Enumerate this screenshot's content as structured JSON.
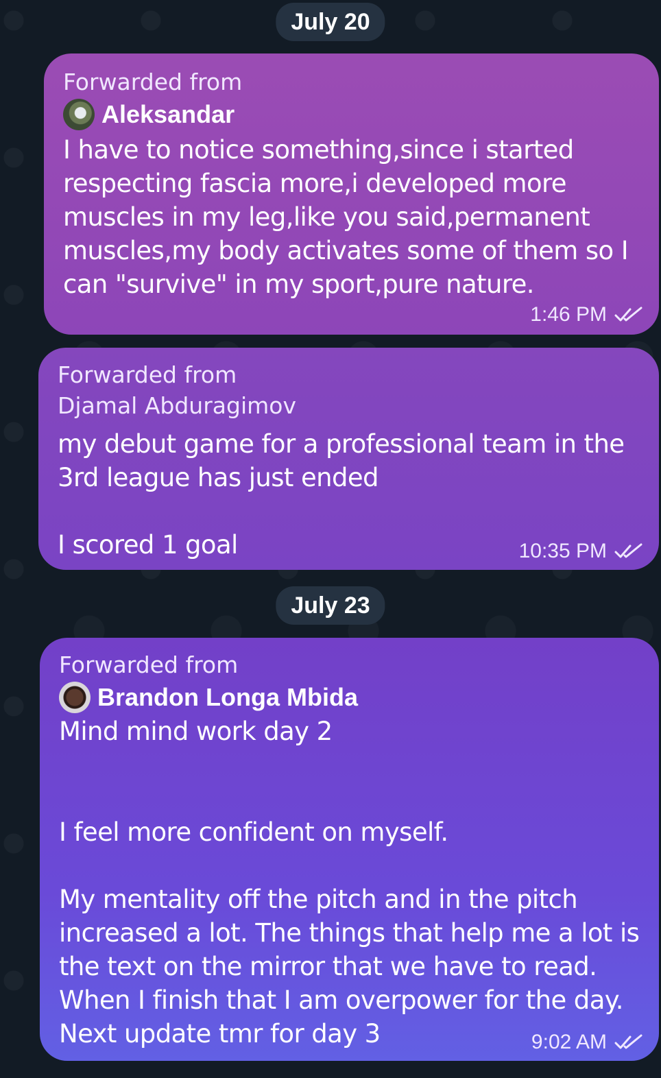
{
  "chat": {
    "date_1": "July 20",
    "date_2": "July 23",
    "messages": [
      {
        "forwarded_label": "Forwarded from",
        "sender": "Aleksandar",
        "text": "I have to notice something,since i started respecting fascia more,i developed more muscles in my leg,like you said,permanent muscles,my body activates some of them so I can \"survive\" in my sport,pure nature.",
        "time": "1:46 PM",
        "status_icon": "double-check-icon"
      },
      {
        "forwarded_label": "Forwarded from",
        "sender": "Djamal Abduragimov",
        "text_1": "my debut game for a professional team in the 3rd league has just ended",
        "text_2": "I scored 1 goal",
        "time": "10:35 PM",
        "status_icon": "double-check-icon"
      },
      {
        "forwarded_label": "Forwarded from",
        "sender": "Brandon Longa Mbida",
        "text_1": "Mind mind work day 2",
        "text_2": "I feel more confident on myself.",
        "text_3": "My mentality off the pitch and in the pitch increased a lot. The things that help me a lot is the text on the mirror that we have to read. When I finish that I am overpower for the day.",
        "text_4": "Next update tmr for day 3",
        "time": "9:02 AM",
        "status_icon": "double-check-icon"
      }
    ]
  },
  "colors": {
    "background": "#121b25",
    "date_pill": "#253241",
    "bubble_1": "#9b4cb4",
    "bubble_2": "#8547bd",
    "bubble_3": "#6a4ad8"
  }
}
